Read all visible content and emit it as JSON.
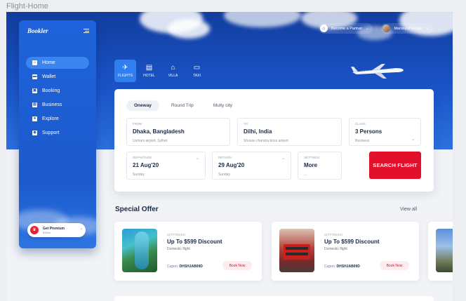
{
  "frame_label": "Flight-Home",
  "brand": {
    "logo": "Bookler"
  },
  "sidebar": {
    "items": [
      {
        "label": "Home",
        "icon": "home-icon",
        "glyph": "⌂",
        "active": true
      },
      {
        "label": "Wallet",
        "icon": "wallet-icon",
        "glyph": "▬",
        "active": false
      },
      {
        "label": "Booking",
        "icon": "booking-icon",
        "glyph": "▣",
        "active": false
      },
      {
        "label": "Business",
        "icon": "business-icon",
        "glyph": "▦",
        "active": false
      },
      {
        "label": "Explore",
        "icon": "globe-icon",
        "glyph": "●",
        "active": false
      },
      {
        "label": "Support",
        "icon": "support-icon",
        "glyph": "◆",
        "active": false
      }
    ],
    "premium": {
      "title": "Get Premium",
      "price": "$38/m"
    }
  },
  "topbar": {
    "partner_label": "Become a Partner",
    "user_name": "Mansurul Haque"
  },
  "tabs": [
    {
      "label": "FLIGHTS",
      "glyph": "✈",
      "icon": "flight-icon",
      "active": true
    },
    {
      "label": "HOTEL",
      "glyph": "▤",
      "icon": "hotel-icon",
      "active": false
    },
    {
      "label": "VILLA",
      "glyph": "⌂",
      "icon": "villa-icon",
      "active": false
    },
    {
      "label": "TAXI",
      "glyph": "▭",
      "icon": "taxi-icon",
      "active": false
    }
  ],
  "search": {
    "trip_types": [
      "Oneway",
      "Round Trip",
      "Multy city"
    ],
    "from": {
      "label": "FROM",
      "value": "Dhaka, Bangladesh",
      "sub": "Usmani airport, Sylhet"
    },
    "to": {
      "label": "TO",
      "value": "Dilhi, India",
      "sub": "Shuvas chandra bosu airport"
    },
    "class": {
      "label": "CLASS",
      "value": "3 Persons",
      "sub": "Business"
    },
    "departure": {
      "label": "DEPARTURE",
      "value": "21 Aug'20",
      "sub": "Sunday"
    },
    "return": {
      "label": "RETURN",
      "value": "29 Aug'20",
      "sub": "Sunday"
    },
    "settings": {
      "label": "SETTINGS",
      "value": "More",
      "sub": "..."
    },
    "button": "SEARCH FLIGHT"
  },
  "offers": {
    "title": "Special Offer",
    "view_all": "View all",
    "items": [
      {
        "tag": "CITYTOUCH",
        "title": "Up To $599 Discount",
        "subtitle": "Domestic flight",
        "coupon_label": "Cupon:",
        "coupon_code": "DHSHJAB09D",
        "button": "Book Now"
      },
      {
        "tag": "CITYTOUCH",
        "title": "Up To $599 Discount",
        "subtitle": "Domestic flight",
        "coupon_label": "Cupon:",
        "coupon_code": "DHSHJAB09D",
        "button": "Book Now"
      }
    ]
  },
  "colors": {
    "primary": "#1f63da",
    "accent": "#e3102c",
    "text": "#1b2a4a"
  }
}
